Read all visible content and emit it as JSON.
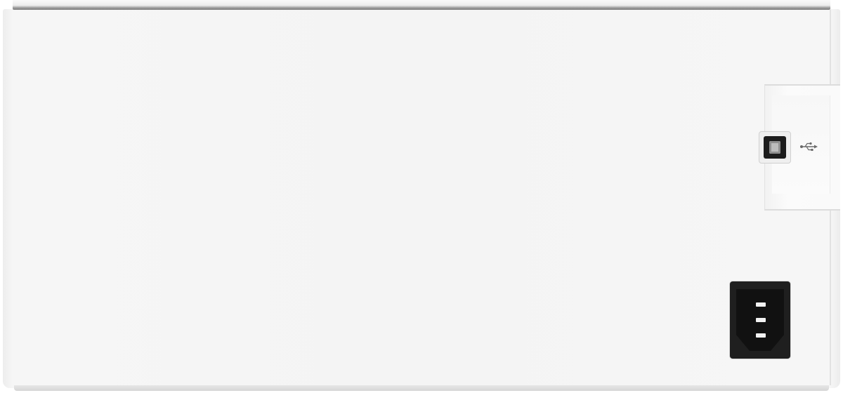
{
  "scene": {
    "subject": "printer-rear-panel",
    "colors": {
      "background": "#ffffff",
      "body": "#f4f4f4",
      "port": "#1c1c1c",
      "pins": "#f2f2f2"
    },
    "icons": [
      "usb-icon"
    ]
  }
}
